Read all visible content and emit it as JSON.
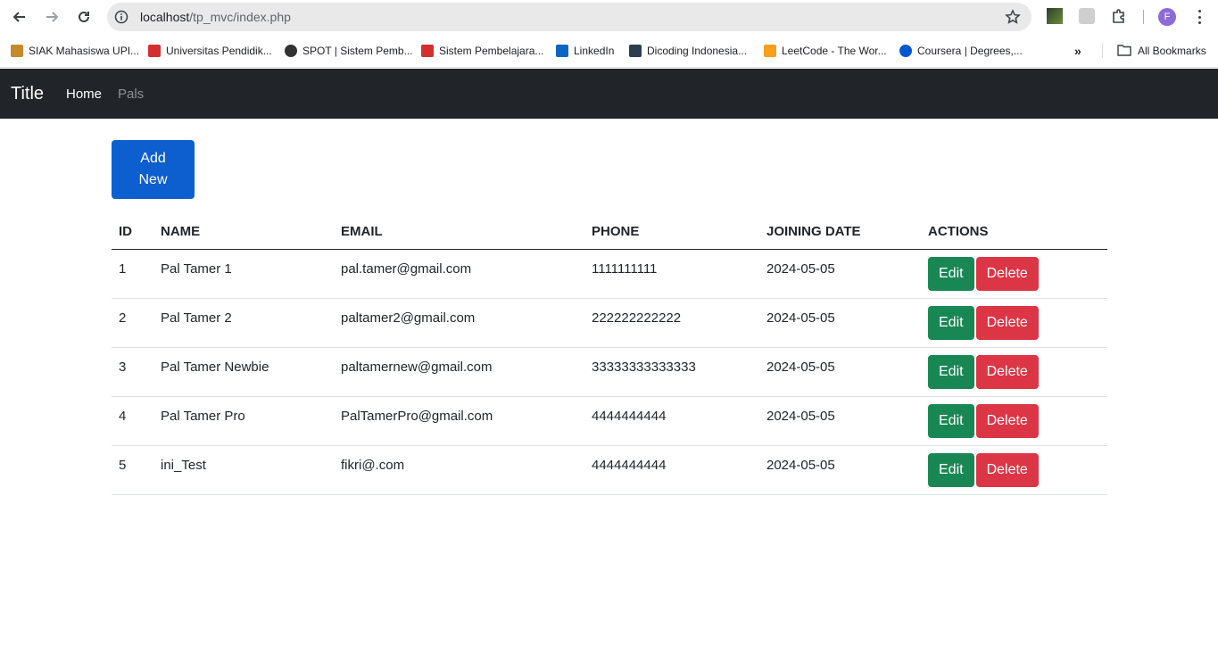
{
  "browser": {
    "url_host": "localhost",
    "url_path": "/tp_mvc/index.php",
    "profile_initial": "F",
    "bookmarks": [
      {
        "label": "SIAK Mahasiswa UPI...",
        "color": "#c58a2a"
      },
      {
        "label": "Universitas Pendidik...",
        "color": "#d32f2f"
      },
      {
        "label": "SPOT | Sistem Pemb...",
        "color": "#333333"
      },
      {
        "label": "Sistem Pembelajara...",
        "color": "#d32f2f"
      },
      {
        "label": "LinkedIn",
        "color": "#0a66c2"
      },
      {
        "label": "Dicoding Indonesia...",
        "color": "#2d3e50"
      },
      {
        "label": "LeetCode - The Wor...",
        "color": "#f89f1b"
      },
      {
        "label": "Coursera | Degrees,...",
        "color": "#0056d2"
      }
    ],
    "all_bookmarks_label": "All Bookmarks"
  },
  "navbar": {
    "brand": "Title",
    "links": [
      "Home",
      "Pals"
    ]
  },
  "add_button_label": "Add New",
  "table": {
    "headers": [
      "ID",
      "NAME",
      "EMAIL",
      "PHONE",
      "JOINING DATE",
      "ACTIONS"
    ],
    "rows": [
      {
        "id": "1",
        "name": "Pal Tamer 1",
        "email": "pal.tamer@gmail.com",
        "phone": "1111111111",
        "date": "2024-05-05"
      },
      {
        "id": "2",
        "name": "Pal Tamer 2",
        "email": "paltamer2@gmail.com",
        "phone": "222222222222",
        "date": "2024-05-05"
      },
      {
        "id": "3",
        "name": "Pal Tamer Newbie",
        "email": "paltamernew@gmail.com",
        "phone": "33333333333333",
        "date": "2024-05-05"
      },
      {
        "id": "4",
        "name": "Pal Tamer Pro",
        "email": "PalTamerPro@gmail.com",
        "phone": "4444444444",
        "date": "2024-05-05"
      },
      {
        "id": "5",
        "name": "ini_Test",
        "email": "fikri@.com",
        "phone": "4444444444",
        "date": "2024-05-05"
      }
    ],
    "edit_label": "Edit",
    "delete_label": "Delete"
  }
}
